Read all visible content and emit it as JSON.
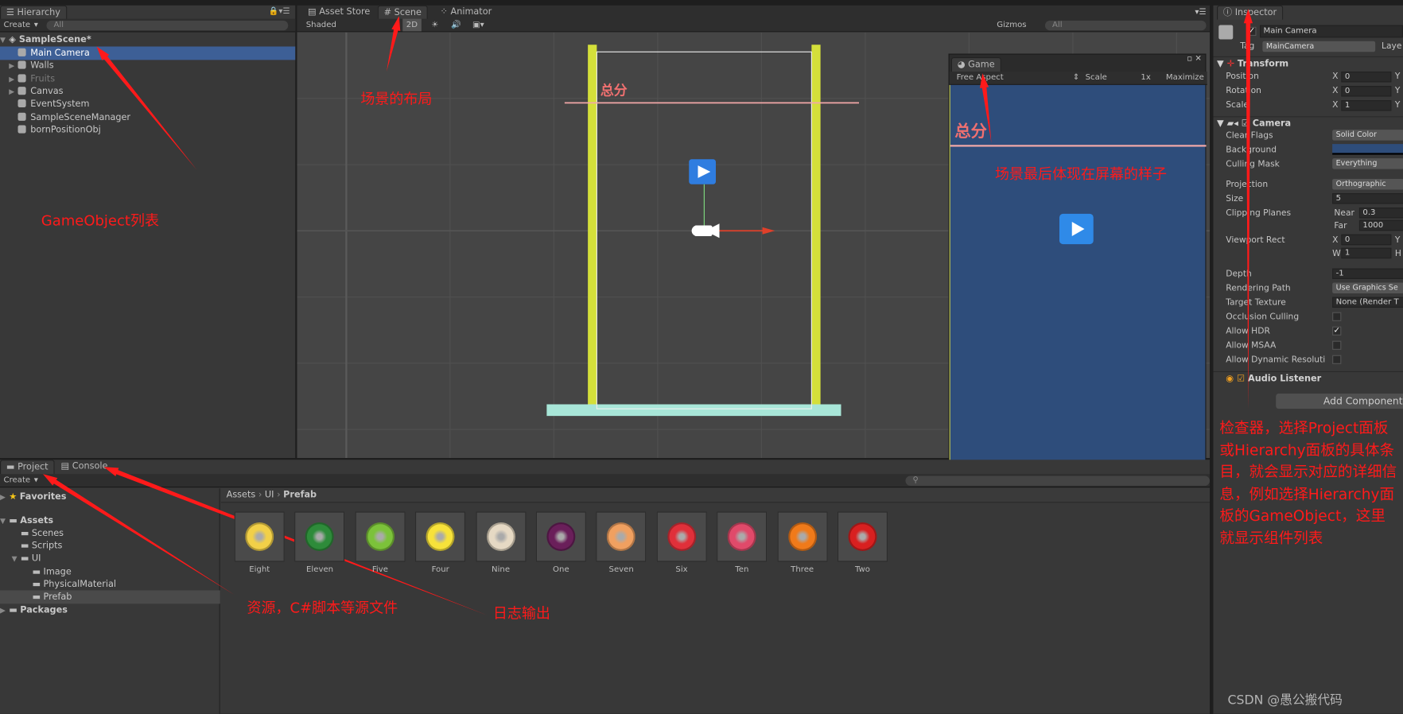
{
  "hierarchy": {
    "tab": "Hierarchy",
    "create": "Create",
    "search_placeholder": "All",
    "scene": "SampleScene*",
    "items": [
      {
        "label": "Main Camera",
        "selected": true
      },
      {
        "label": "Walls",
        "expandable": true
      },
      {
        "label": "Fruits",
        "expandable": true,
        "inactive": true
      },
      {
        "label": "Canvas",
        "expandable": true
      },
      {
        "label": "EventSystem"
      },
      {
        "label": "SampleSceneManager"
      },
      {
        "label": "bornPositionObj"
      }
    ]
  },
  "center_tabs": [
    "Asset Store",
    "Scene",
    "Animator"
  ],
  "scene": {
    "shading": "Shaded",
    "mode_2d": "2D",
    "gizmos": "Gizmos",
    "search_placeholder": "All",
    "score_label": "总分"
  },
  "game": {
    "tab": "Game",
    "aspect": "Free Aspect",
    "scale_label": "Scale",
    "scale_value": "1x",
    "maximize": "Maximize",
    "score_label": "总分",
    "background": "#2e4d7b"
  },
  "inspector": {
    "tab": "Inspector",
    "object_name": "Main Camera",
    "tag_label": "Tag",
    "tag": "MainCamera",
    "layer_label": "Laye",
    "transform": {
      "title": "Transform",
      "rows": [
        {
          "label": "Position",
          "x": "0"
        },
        {
          "label": "Rotation",
          "x": "0"
        },
        {
          "label": "Scale",
          "x": "1"
        }
      ]
    },
    "camera": {
      "title": "Camera",
      "clear_flags_label": "Clear Flags",
      "clear_flags": "Solid Color",
      "background_label": "Background",
      "background_color": "#2e4d7b",
      "culling_label": "Culling Mask",
      "culling": "Everything",
      "projection_label": "Projection",
      "projection": "Orthographic",
      "size_label": "Size",
      "size": "5",
      "clipping_label": "Clipping Planes",
      "near_label": "Near",
      "near": "0.3",
      "far_label": "Far",
      "far": "1000",
      "viewport_label": "Viewport Rect",
      "viewport_x": "0",
      "viewport_w": "1",
      "depth_label": "Depth",
      "depth": "-1",
      "rendering_label": "Rendering Path",
      "rendering": "Use Graphics Se",
      "target_label": "Target Texture",
      "target": "None (Render T",
      "occlusion_label": "Occlusion Culling",
      "occlusion": false,
      "hdr_label": "Allow HDR",
      "hdr": true,
      "msaa_label": "Allow MSAA",
      "msaa": false,
      "dynres_label": "Allow Dynamic Resoluti",
      "dynres": false
    },
    "audio": {
      "title": "Audio Listener"
    },
    "add_component": "Add Component"
  },
  "project": {
    "tabs": [
      "Project",
      "Console"
    ],
    "create": "Create",
    "tree": [
      {
        "label": "Favorites",
        "level": 0,
        "bold": true
      },
      {
        "label": "Assets",
        "level": 0,
        "bold": true
      },
      {
        "label": "Scenes",
        "level": 1
      },
      {
        "label": "Scripts",
        "level": 1
      },
      {
        "label": "UI",
        "level": 1
      },
      {
        "label": "Image",
        "level": 2
      },
      {
        "label": "PhysicalMaterial",
        "level": 2
      },
      {
        "label": "Prefab",
        "level": 2,
        "selected": true
      },
      {
        "label": "Packages",
        "level": 0,
        "bold": true
      }
    ],
    "breadcrumb": [
      "Assets",
      "UI",
      "Prefab"
    ],
    "assets": [
      {
        "name": "Eight",
        "color": "#f2d048"
      },
      {
        "name": "Eleven",
        "color": "#2e8b3a"
      },
      {
        "name": "Five",
        "color": "#7cc23a"
      },
      {
        "name": "Four",
        "color": "#f7e23a"
      },
      {
        "name": "Nine",
        "color": "#e6d9c4"
      },
      {
        "name": "One",
        "color": "#6a1f5a"
      },
      {
        "name": "Seven",
        "color": "#f0a060"
      },
      {
        "name": "Six",
        "color": "#e0303a"
      },
      {
        "name": "Ten",
        "color": "#e04a6a"
      },
      {
        "name": "Three",
        "color": "#f07a1a"
      },
      {
        "name": "Two",
        "color": "#d82020"
      }
    ]
  },
  "annotations": {
    "hierarchy": "GameObject列表",
    "scene": "场景的布局",
    "game": "场景最后体现在屏幕的样子",
    "inspector": "检查器，选择Project面板或Hierarchy面板的具体条目，就会显示对应的详细信息，例如选择Hierarchy面板的GameObject，这里就显示组件列表",
    "project": "资源，C#脚本等源文件",
    "console": "日志输出",
    "color": "#ff1a1a"
  },
  "watermark": "CSDN @愚公搬代码"
}
